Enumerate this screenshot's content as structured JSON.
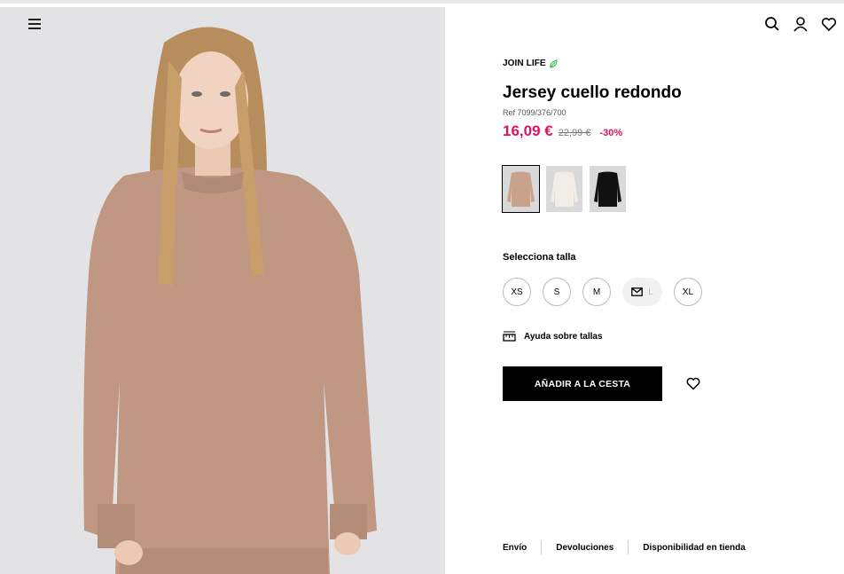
{
  "header": {
    "menu_icon": "hamburger-icon",
    "icons": [
      "search-icon",
      "user-icon",
      "heart-icon"
    ]
  },
  "product": {
    "badge": "JOIN LIFE",
    "title": "Jersey cuello redondo",
    "ref": "Ref 7099/376/700",
    "price_current": "16,09 €",
    "price_original": "22,99 €",
    "discount": "-30%",
    "accent_color": "#e0115f"
  },
  "colors": [
    {
      "name": "camel",
      "hex": "#c9a28c",
      "selected": true
    },
    {
      "name": "cream",
      "hex": "#f1ede6",
      "selected": false
    },
    {
      "name": "black",
      "hex": "#111111",
      "selected": false
    }
  ],
  "size_section": {
    "label": "Selecciona talla",
    "sizes": [
      {
        "label": "XS",
        "available": true
      },
      {
        "label": "S",
        "available": true
      },
      {
        "label": "M",
        "available": true
      },
      {
        "label": "L",
        "available": false
      },
      {
        "label": "XL",
        "available": true
      }
    ]
  },
  "help": {
    "label": "Ayuda sobre tallas",
    "icon": "ruler-icon"
  },
  "actions": {
    "add_to_cart": "AÑADIR A LA CESTA",
    "wishlist_icon": "heart-icon"
  },
  "footer": {
    "links": [
      "Envío",
      "Devoluciones",
      "Disponibilidad en tienda"
    ]
  }
}
